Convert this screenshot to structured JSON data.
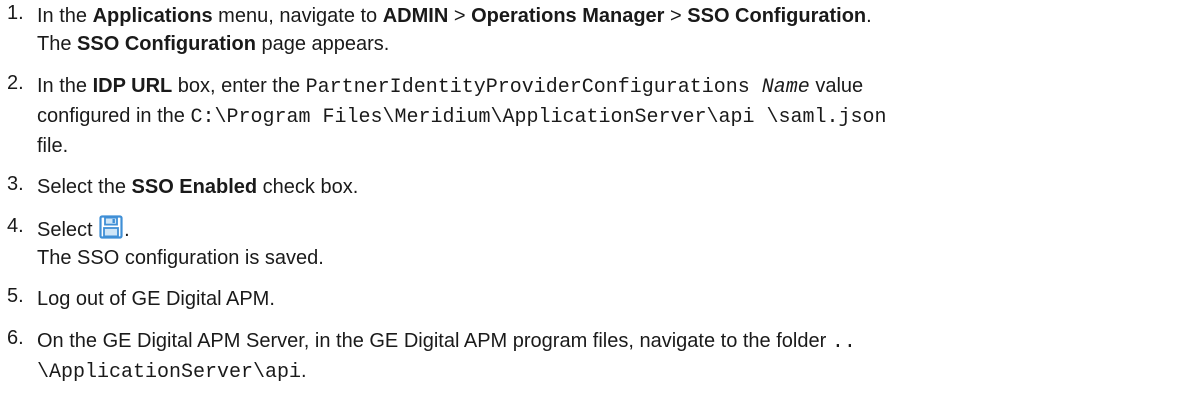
{
  "steps": [
    {
      "num": "1.",
      "pre": "In the ",
      "applications": "Applications",
      "mid1": " menu, navigate to ",
      "admin": "ADMIN",
      "sep1": " > ",
      "ops": "Operations Manager",
      "sep2": " > ",
      "sso": "SSO Configuration",
      "end": ".",
      "result_pre": "The ",
      "result_bold": "SSO Configuration",
      "result_post": " page appears."
    },
    {
      "num": "2.",
      "pre": "In the ",
      "idp": "IDP URL",
      "mid": " box, enter the ",
      "code1": "PartnerIdentityProviderConfigurations",
      "name_code": "Name",
      "value": " value",
      "line2_pre": "configured in the ",
      "path": "C:\\Program Files\\Meridium\\ApplicationServer\\api \\saml.json",
      "line3": "file."
    },
    {
      "num": "3.",
      "pre": "Select the ",
      "bold": "SSO Enabled",
      "post": " check box."
    },
    {
      "num": "4.",
      "pre": "Select ",
      "icon": "save-icon",
      "post": ".",
      "result": "The SSO configuration is saved."
    },
    {
      "num": "5.",
      "text": "Log out of GE Digital APM."
    },
    {
      "num": "6.",
      "text": "On the GE Digital APM Server, in the GE Digital APM program files, navigate to the folder ",
      "code_a": "..",
      "code_b": "\\ApplicationServer\\api",
      "end": "."
    }
  ],
  "colors": {
    "text": "#1a1a1a",
    "icon_fill": "#3f8fd6",
    "icon_light": "#cfe6f8"
  }
}
